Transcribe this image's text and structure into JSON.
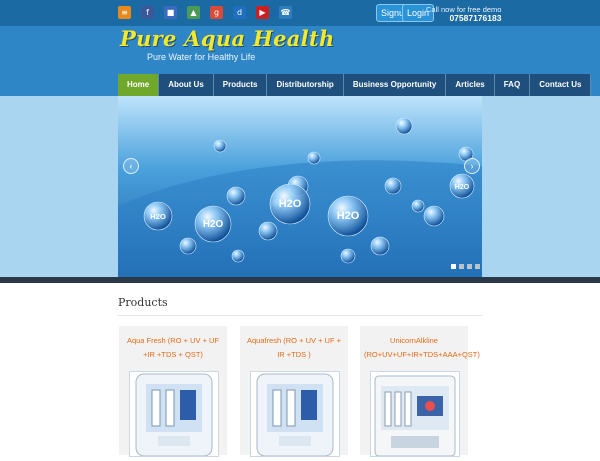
{
  "social_icons": [
    {
      "name": "rss-icon",
      "glyph": "≡",
      "color": "#e8891e"
    },
    {
      "name": "facebook-icon",
      "glyph": "f",
      "color": "#3b5998"
    },
    {
      "name": "delicious-icon",
      "glyph": "■",
      "color": "#3a6bc0"
    },
    {
      "name": "share-icon",
      "glyph": "▲",
      "color": "#4a9a5a"
    },
    {
      "name": "google-icon",
      "glyph": "g",
      "color": "#d94a38"
    },
    {
      "name": "digg-icon",
      "glyph": "d",
      "color": "#1f6fbf"
    },
    {
      "name": "youtube-icon",
      "glyph": "▶",
      "color": "#cc2020"
    },
    {
      "name": "phone-icon",
      "glyph": "☎",
      "color": "#2c7fbf"
    }
  ],
  "top": {
    "signup_label": "Signup",
    "login_label": "Login",
    "call_text": "Call now for free demo",
    "phone": "07587176183"
  },
  "brand": {
    "logo": "Pure Aqua Health",
    "tagline": "Pure Water for Healthy Life"
  },
  "nav": [
    {
      "label": "Home",
      "active": true
    },
    {
      "label": "About Us"
    },
    {
      "label": "Products"
    },
    {
      "label": "Distributorship"
    },
    {
      "label": "Business Opportunity"
    },
    {
      "label": "Articles"
    },
    {
      "label": "FAQ"
    },
    {
      "label": "Contact Us"
    }
  ],
  "slider": {
    "prev": "‹",
    "next": "›",
    "bubble_text": "H2O",
    "active_dot": 0,
    "dot_count": 4
  },
  "products": {
    "title": "Products",
    "items": [
      {
        "name": "Aqua Fresh (RO + UV + UF +IR +TDS + QST)"
      },
      {
        "name": "Aquafresh (RO + UV + UF + IR +TDS )"
      },
      {
        "name": "UnicornAlkline (RO+UV+UF+IR+TDS+AAA+QST)"
      }
    ]
  },
  "colors": {
    "topbar": "#1b6aa3",
    "header": "#2f86c6",
    "nav_active": "#6fa82a",
    "product_name": "#e76a15",
    "logo": "#f3e92a"
  }
}
